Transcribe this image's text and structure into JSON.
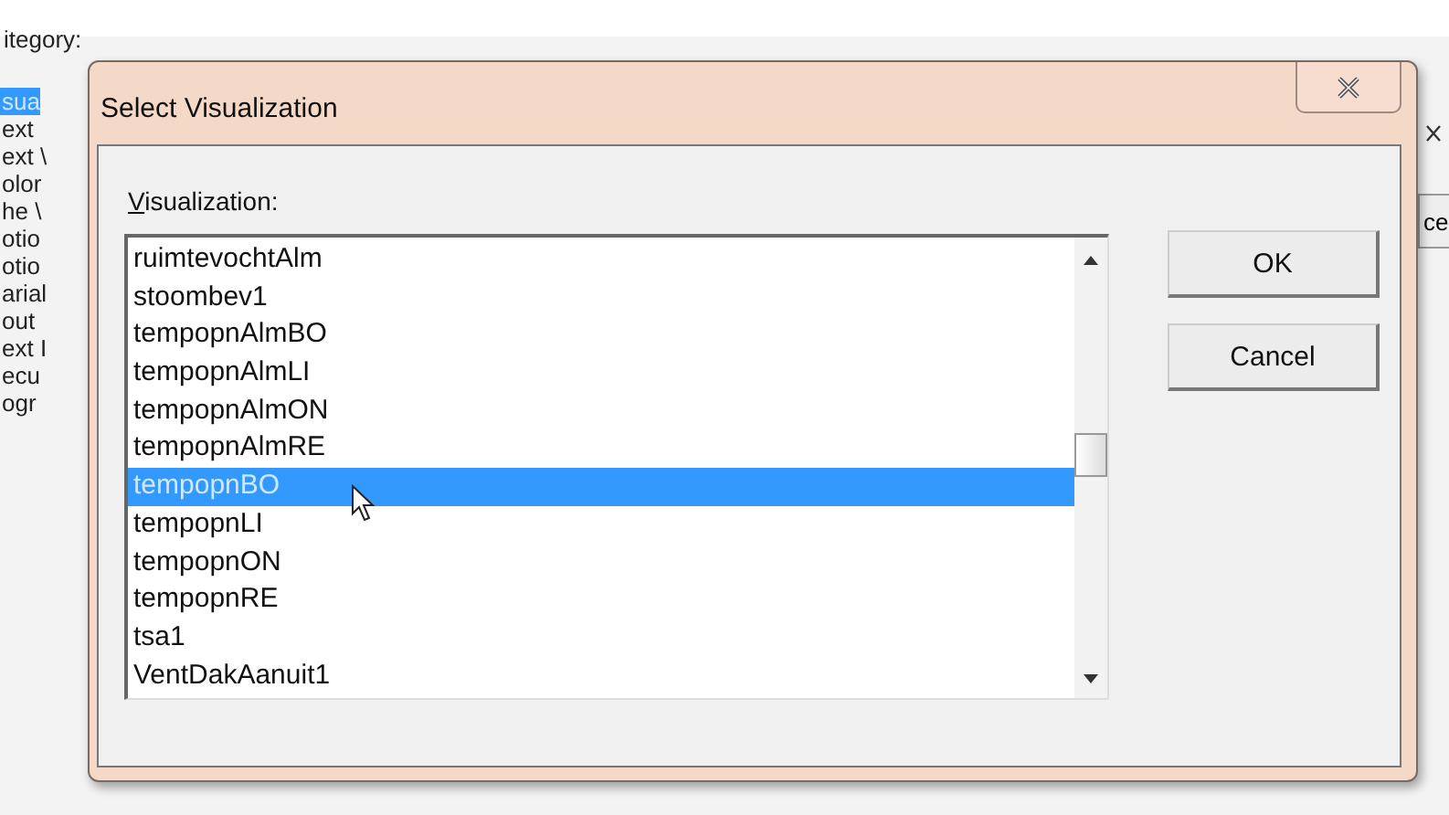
{
  "background": {
    "heading": "itegory:",
    "items": [
      {
        "label": "sua",
        "selected": true
      },
      {
        "label": "ext",
        "selected": false
      },
      {
        "label": "ext \\",
        "selected": false
      },
      {
        "label": "olor",
        "selected": false
      },
      {
        "label": "he \\",
        "selected": false
      },
      {
        "label": "otio",
        "selected": false
      },
      {
        "label": "otio",
        "selected": false
      },
      {
        "label": "arial",
        "selected": false
      },
      {
        "label": "out",
        "selected": false
      },
      {
        "label": "ext I",
        "selected": false
      },
      {
        "label": "ecu",
        "selected": false
      },
      {
        "label": "ogr",
        "selected": false
      }
    ],
    "right_button": "ce"
  },
  "dialog": {
    "title": "Select Visualization",
    "label": "Visualization:",
    "items": [
      {
        "label": "ruimtevochtAlm",
        "selected": false
      },
      {
        "label": "stoombev1",
        "selected": false
      },
      {
        "label": "tempopnAlmBO",
        "selected": false
      },
      {
        "label": "tempopnAlmLI",
        "selected": false
      },
      {
        "label": "tempopnAlmON",
        "selected": false
      },
      {
        "label": "tempopnAlmRE",
        "selected": false
      },
      {
        "label": "tempopnBO",
        "selected": true
      },
      {
        "label": "tempopnLI",
        "selected": false
      },
      {
        "label": "tempopnON",
        "selected": false
      },
      {
        "label": "tempopnRE",
        "selected": false
      },
      {
        "label": "tsa1",
        "selected": false
      },
      {
        "label": "VentDakAanuit1",
        "selected": false
      }
    ],
    "buttons": [
      "OK",
      "Cancel"
    ]
  }
}
